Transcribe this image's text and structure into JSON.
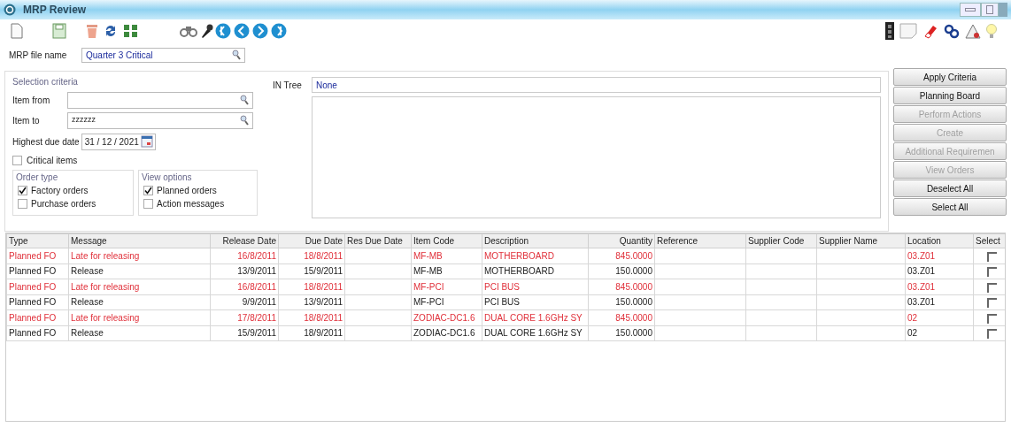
{
  "window": {
    "title": "MRP Review"
  },
  "file": {
    "label": "MRP file name",
    "value": "Quarter 3 Critical"
  },
  "selection": {
    "title": "Selection criteria",
    "item_from": {
      "label": "Item from"
    },
    "item_to": {
      "label": "Item to",
      "value": "zzzzzz"
    },
    "highest_due_date": {
      "label": "Highest due date",
      "value": "31 / 12 / 2021"
    },
    "critical_items": {
      "label": "Critical items",
      "checked": false
    },
    "in_tree": {
      "label": "IN Tree",
      "value": "None"
    },
    "order_type": {
      "title": "Order type",
      "options": [
        {
          "label": "Factory orders",
          "checked": true
        },
        {
          "label": "Purchase orders",
          "checked": false
        }
      ]
    },
    "view_options": {
      "title": "View options",
      "options": [
        {
          "label": "Planned orders",
          "checked": true
        },
        {
          "label": "Action messages",
          "checked": false
        }
      ]
    }
  },
  "actions": [
    {
      "label": "Apply Criteria",
      "disabled": false
    },
    {
      "label": "Planning Board",
      "disabled": false
    },
    {
      "label": "Perform Actions",
      "disabled": true
    },
    {
      "label": "Create",
      "disabled": true
    },
    {
      "label": "Additional Requiremen",
      "disabled": true
    },
    {
      "label": "View Orders",
      "disabled": true
    },
    {
      "label": "Deselect All",
      "disabled": false
    },
    {
      "label": "Select All",
      "disabled": false
    }
  ],
  "table": {
    "columns": [
      "Type",
      "Message",
      "Release Date",
      "Due Date",
      "Res Due Date",
      "Item Code",
      "Description",
      "Quantity",
      "Reference",
      "Supplier Code",
      "Supplier Name",
      "Location",
      "Select"
    ],
    "rows": [
      {
        "overdue": true,
        "selected": false,
        "cells": [
          "Planned FO",
          "Late for releasing",
          "16/8/2011",
          "18/8/2011",
          "",
          "MF-MB",
          "MOTHERBOARD",
          "845.0000",
          "",
          "",
          "",
          "03.Z01"
        ]
      },
      {
        "overdue": false,
        "selected": false,
        "cells": [
          "Planned FO",
          "Release",
          "13/9/2011",
          "15/9/2011",
          "",
          "MF-MB",
          "MOTHERBOARD",
          "150.0000",
          "",
          "",
          "",
          "03.Z01"
        ]
      },
      {
        "overdue": true,
        "selected": false,
        "cells": [
          "Planned FO",
          "Late for releasing",
          "16/8/2011",
          "18/8/2011",
          "",
          "MF-PCI",
          "PCI BUS",
          "845.0000",
          "",
          "",
          "",
          "03.Z01"
        ]
      },
      {
        "overdue": false,
        "selected": false,
        "cells": [
          "Planned FO",
          "Release",
          "9/9/2011",
          "13/9/2011",
          "",
          "MF-PCI",
          "PCI BUS",
          "150.0000",
          "",
          "",
          "",
          "03.Z01"
        ]
      },
      {
        "overdue": true,
        "selected": false,
        "cells": [
          "Planned FO",
          "Late for releasing",
          "17/8/2011",
          "18/8/2011",
          "",
          "ZODIAC-DC1.6",
          "DUAL CORE 1.6GHz SY",
          "845.0000",
          "",
          "",
          "",
          "02"
        ]
      },
      {
        "overdue": false,
        "selected": false,
        "cells": [
          "Planned FO",
          "Release",
          "15/9/2011",
          "18/9/2011",
          "",
          "ZODIAC-DC1.6",
          "DUAL CORE 1.6GHz SY",
          "150.0000",
          "",
          "",
          "",
          "02"
        ]
      }
    ]
  }
}
